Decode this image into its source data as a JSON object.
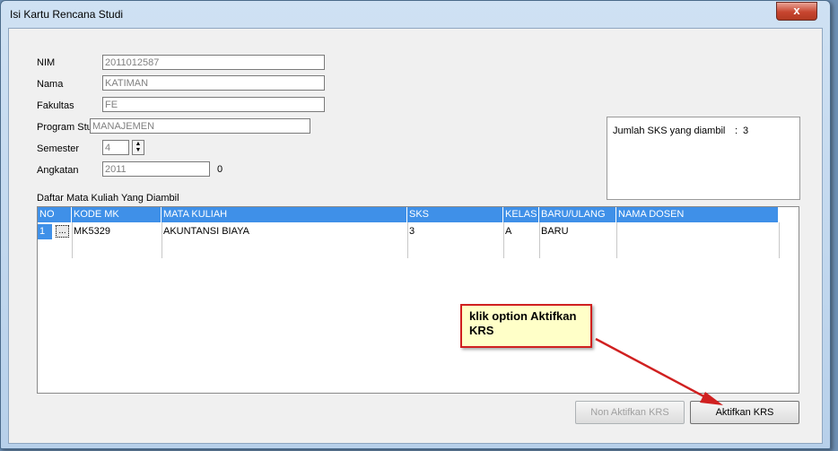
{
  "window": {
    "title": "Isi Kartu Rencana Studi",
    "close_label": "x"
  },
  "form": {
    "nim": {
      "label": "NIM",
      "value": "2011012587"
    },
    "nama": {
      "label": "Nama",
      "value": "KATIMAN"
    },
    "fakultas": {
      "label": "Fakultas",
      "value": "FE"
    },
    "program_studi": {
      "label": "Program Studi",
      "value": "MANAJEMEN"
    },
    "semester": {
      "label": "Semester",
      "value": "4"
    },
    "angkatan": {
      "label": "Angkatan",
      "value": "2011",
      "extra": "0"
    }
  },
  "summary": {
    "label": "Jumlah SKS yang diambil",
    "separator": ":",
    "value": "3"
  },
  "table": {
    "caption": "Daftar Mata Kuliah Yang Diambil",
    "columns": [
      "NO",
      "KODE MK",
      "MATA KULIAH",
      "SKS",
      "KELAS",
      "BARU/ULANG",
      "NAMA DOSEN"
    ],
    "rows": [
      {
        "no": "1",
        "button": "...",
        "kode_mk": "MK5329",
        "mata_kuliah": "AKUNTANSI BIAYA",
        "sks": "3",
        "kelas": "A",
        "baru_ulang": "BARU",
        "nama_dosen": ""
      }
    ]
  },
  "buttons": {
    "non_aktifkan": "Non Aktifkan KRS",
    "aktifkan": "Aktifkan KRS"
  },
  "annotation": {
    "text": "klik option Aktifkan KRS",
    "color": "#d02020"
  },
  "colors": {
    "header": "#3f90e8",
    "selection": "#3f90e8"
  }
}
